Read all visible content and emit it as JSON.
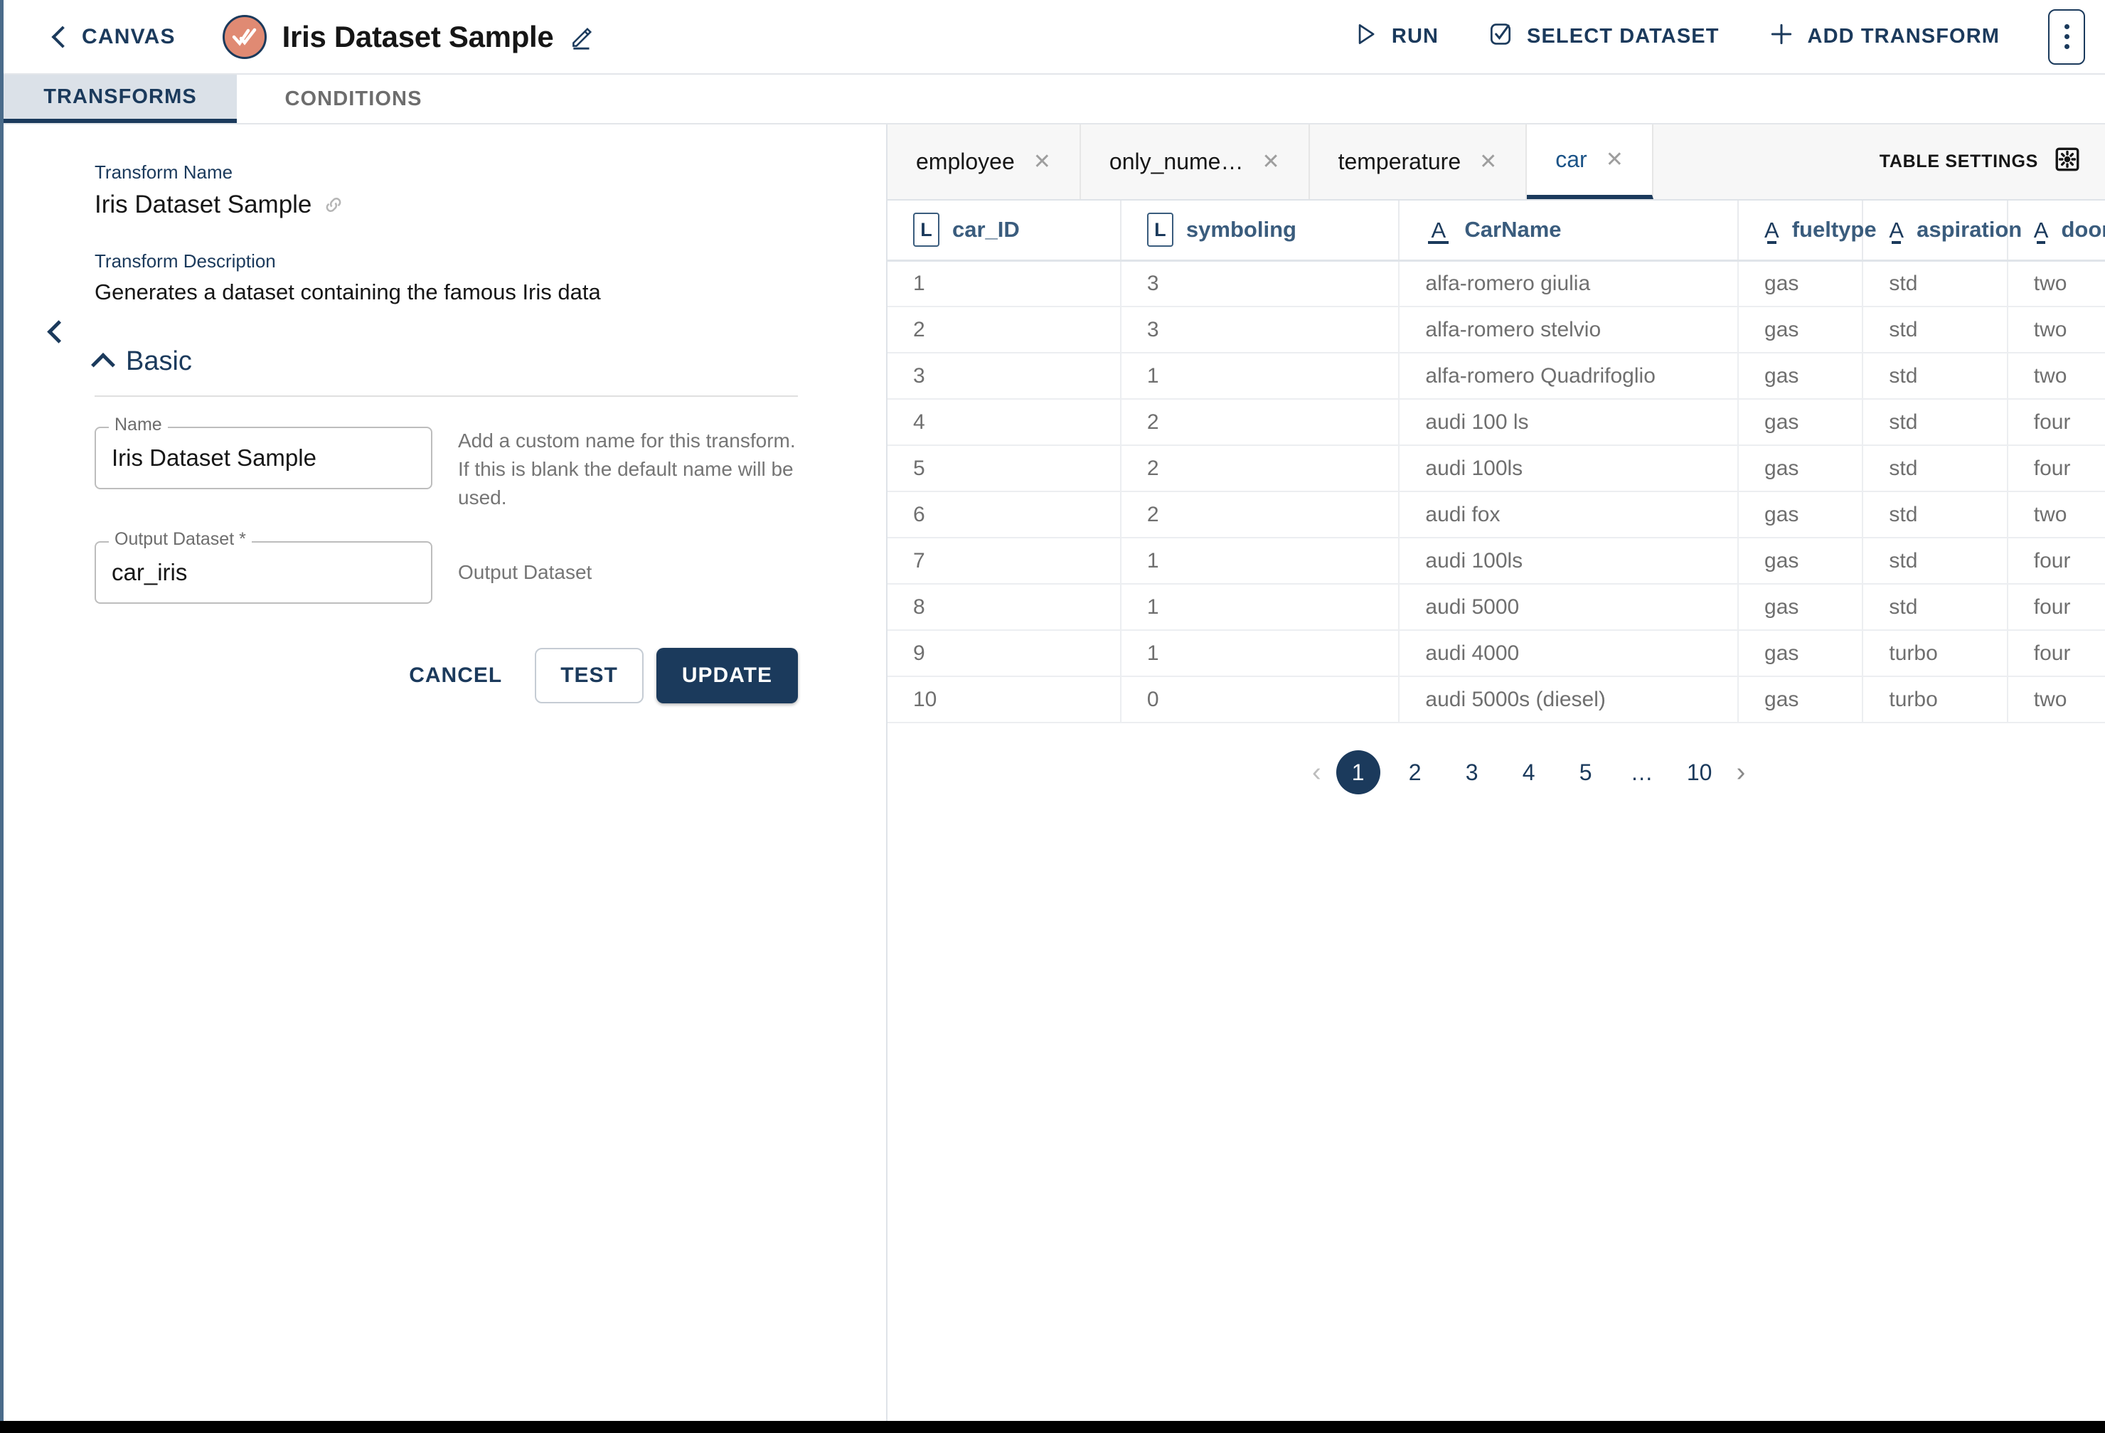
{
  "header": {
    "back_label": "CANVAS",
    "title": "Iris Dataset Sample",
    "actions": [
      {
        "label": "RUN",
        "icon": "play-icon"
      },
      {
        "label": "SELECT DATASET",
        "icon": "checkbox-check-icon"
      },
      {
        "label": "ADD TRANSFORM",
        "icon": "plus-icon"
      }
    ],
    "logo_color": "#e08a73",
    "accent_color": "#1b3a5c"
  },
  "top_tabs": [
    {
      "label": "TRANSFORMS",
      "active": true
    },
    {
      "label": "CONDITIONS",
      "active": false
    }
  ],
  "left_panel": {
    "transform_name_label": "Transform Name",
    "transform_name_value": "Iris Dataset Sample",
    "transform_description_label": "Transform Description",
    "transform_description_value": "Generates a dataset containing the famous Iris data",
    "section_title": "Basic",
    "fields": [
      {
        "label": "Name",
        "value": "Iris Dataset Sample",
        "helper": "Add a custom name for this transform. If this is blank the default name will be used."
      },
      {
        "label": "Output Dataset *",
        "value": "car_iris",
        "helper": "Output Dataset"
      }
    ],
    "buttons": {
      "cancel": "CANCEL",
      "test": "TEST",
      "update": "UPDATE"
    }
  },
  "right_panel": {
    "dataset_tabs": [
      {
        "label": "employee",
        "active": false
      },
      {
        "label": "only_nume…",
        "active": false
      },
      {
        "label": "temperature",
        "active": false
      },
      {
        "label": "car",
        "active": true
      }
    ],
    "table_settings_label": "TABLE SETTINGS",
    "table": {
      "columns": [
        {
          "name": "car_ID",
          "type_icon": "L"
        },
        {
          "name": "symboling",
          "type_icon": "L"
        },
        {
          "name": "CarName",
          "type_icon": "A"
        },
        {
          "name": "fueltype",
          "type_icon": "A"
        },
        {
          "name": "aspiration",
          "type_icon": "A"
        },
        {
          "name": "doornumber",
          "type_icon": "A"
        }
      ],
      "rows": [
        [
          "1",
          "3",
          "alfa-romero giulia",
          "gas",
          "std",
          "two"
        ],
        [
          "2",
          "3",
          "alfa-romero stelvio",
          "gas",
          "std",
          "two"
        ],
        [
          "3",
          "1",
          "alfa-romero Quadrifoglio",
          "gas",
          "std",
          "two"
        ],
        [
          "4",
          "2",
          "audi 100 ls",
          "gas",
          "std",
          "four"
        ],
        [
          "5",
          "2",
          "audi 100ls",
          "gas",
          "std",
          "four"
        ],
        [
          "6",
          "2",
          "audi fox",
          "gas",
          "std",
          "two"
        ],
        [
          "7",
          "1",
          "audi 100ls",
          "gas",
          "std",
          "four"
        ],
        [
          "8",
          "1",
          "audi 5000",
          "gas",
          "std",
          "four"
        ],
        [
          "9",
          "1",
          "audi 4000",
          "gas",
          "turbo",
          "four"
        ],
        [
          "10",
          "0",
          "audi 5000s (diesel)",
          "gas",
          "turbo",
          "two"
        ]
      ]
    },
    "pagination": {
      "prev": "‹",
      "next": "›",
      "pages": [
        "1",
        "2",
        "3",
        "4",
        "5",
        "…",
        "10"
      ],
      "current": "1"
    }
  }
}
